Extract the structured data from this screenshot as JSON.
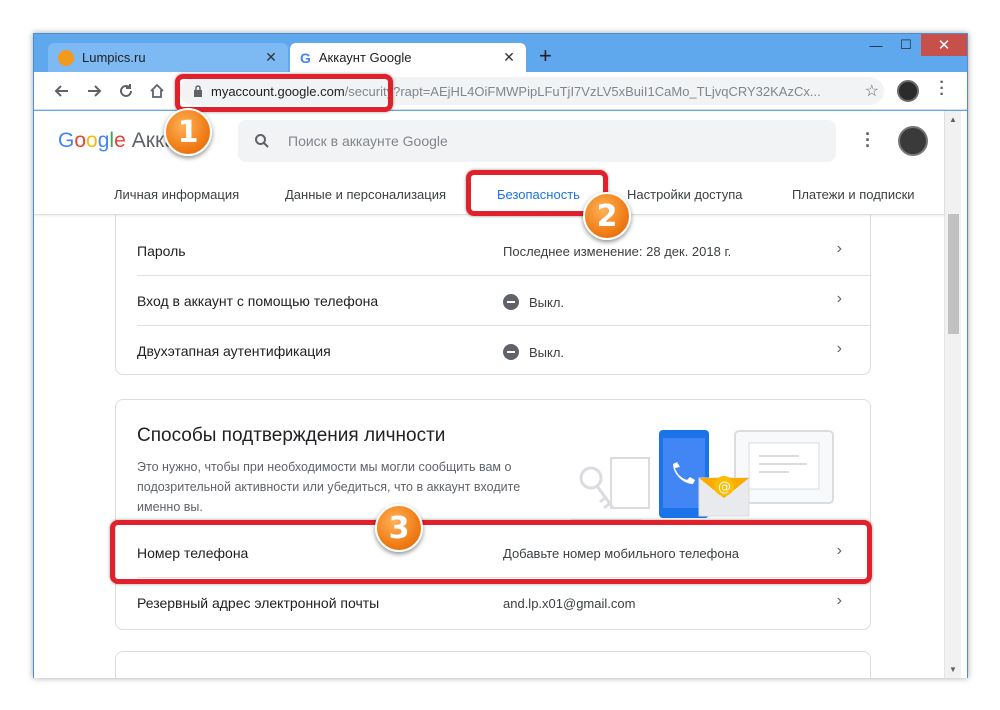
{
  "browser": {
    "tabs": [
      {
        "title": "Lumpics.ru",
        "active": false
      },
      {
        "title": "Аккаунт Google",
        "active": true
      }
    ],
    "new_tab_label": "+",
    "address": {
      "host": "myaccount.google.com",
      "path": "/security?rapt=AEjHL4OiFMWPipLFuTjI7VzLV5xBuiI1CaMo_TLjvqCRY32KAzCx..."
    }
  },
  "header": {
    "logo_google": [
      "G",
      "o",
      "o",
      "g",
      "l",
      "e"
    ],
    "logo_suffix": "Аккаунт",
    "search_placeholder": "Поиск в аккаунте Google",
    "nav_tabs": [
      "Личная информация",
      "Данные и персонализация",
      "Безопасность",
      "Настройки доступа",
      "Платежи и подписки"
    ],
    "selected_tab": "Безопасность"
  },
  "signin_card": {
    "rows": [
      {
        "label": "Пароль",
        "value": "Последнее изменение: 28 дек. 2018 г."
      },
      {
        "label": "Вход в аккаунт с помощью телефона",
        "value": "Выкл."
      },
      {
        "label": "Двухэтапная аутентификация",
        "value": "Выкл."
      }
    ]
  },
  "verify_card": {
    "title": "Способы подтверждения личности",
    "description": "Это нужно, чтобы при необходимости мы могли сообщить вам о подозрительной активности или убедиться, что в аккаунт входите именно вы.",
    "rows": [
      {
        "label": "Номер телефона",
        "value": "Добавьте номер мобильного телефона"
      },
      {
        "label": "Резервный адрес электронной почты",
        "value": "and.lp.x01@gmail.com"
      }
    ]
  },
  "annotations": {
    "step1": "1",
    "step2": "2",
    "step3": "3"
  },
  "colors": {
    "accent": "#1a73e8",
    "marker": "#e0202a",
    "badge": "#f07d16",
    "titlebar": "#5fa8ee"
  }
}
